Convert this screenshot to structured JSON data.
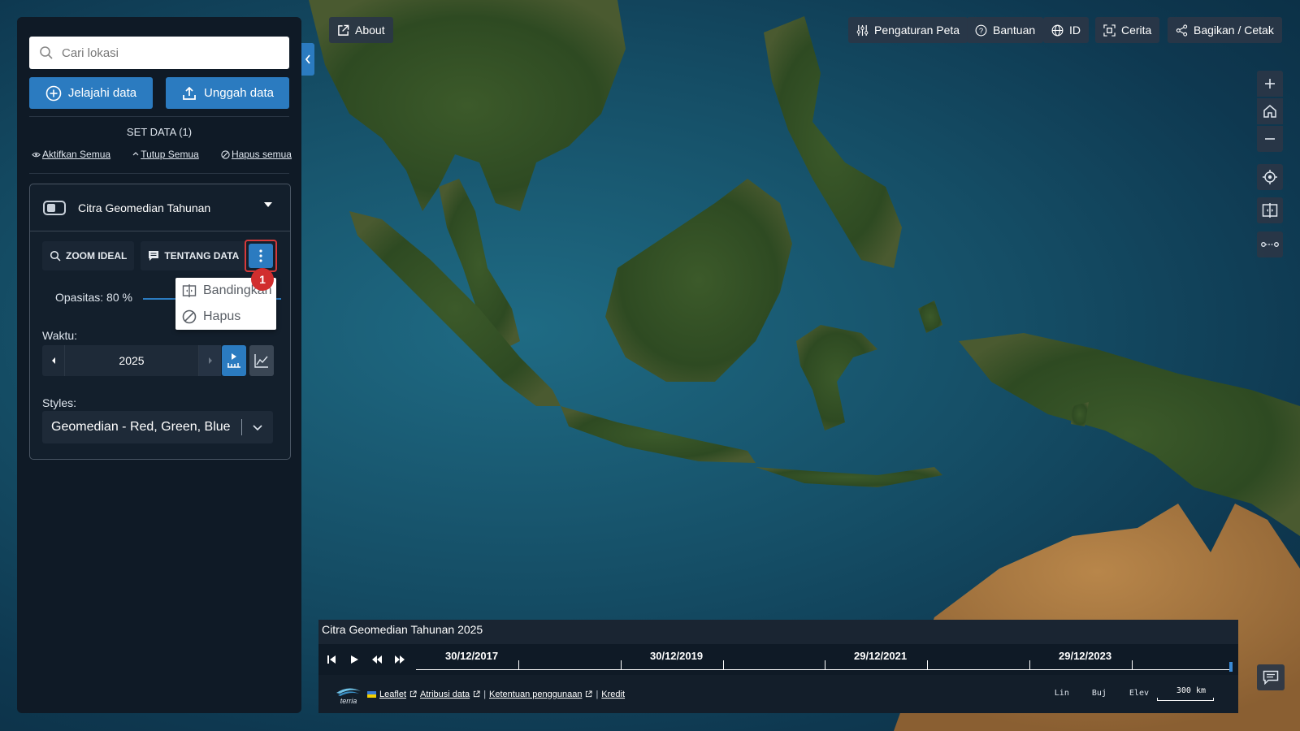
{
  "search": {
    "placeholder": "Cari lokasi"
  },
  "panel": {
    "explore_label": "Jelajahi data",
    "upload_label": "Unggah data",
    "set_title": "SET DATA (1)",
    "enable_all": "Aktifkan Semua",
    "collapse_all": "Tutup Semua",
    "remove_all": "Hapus semua"
  },
  "dataset": {
    "title": "Citra Geomedian Tahunan",
    "zoom_label": "ZOOM IDEAL",
    "about_label": "TENTANG DATA",
    "badge": "1",
    "opacity_label": "Opasitas: 80 %",
    "opacity": 0.8,
    "menu": [
      "Bandingkan",
      "Hapus"
    ],
    "time_label": "Waktu:",
    "year": "2025",
    "styles_label": "Styles:",
    "style_value": "Geomedian - Red, Green, Blue"
  },
  "topbar": {
    "about": "About",
    "map_settings": "Pengaturan Peta",
    "help": "Bantuan",
    "lang": "ID",
    "stories": "Cerita",
    "share": "Bagikan / Cetak"
  },
  "timeline": {
    "title": "Citra Geomedian Tahunan 2025",
    "labels": [
      "30/12/2017",
      "30/12/2019",
      "29/12/2021",
      "29/12/2023"
    ]
  },
  "footer": {
    "leaflet": "Leaflet",
    "attribution": "Atribusi data",
    "terms": "Ketentuan penggunaan",
    "credits": "Kredit",
    "sep": "|",
    "lat": "Lin",
    "lon": "Buj",
    "elev": "Elev",
    "scale": "300 km"
  },
  "colors": {
    "accent": "#2b7bc0",
    "panel": "#0f1a26",
    "highlight": "#d63a3a"
  }
}
